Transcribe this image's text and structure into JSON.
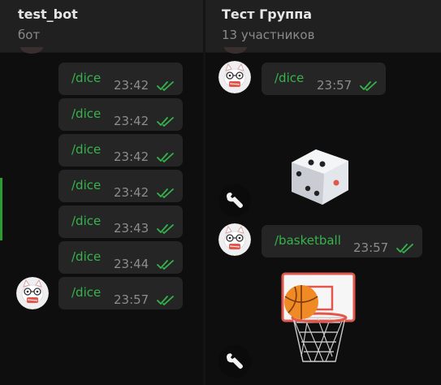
{
  "left_chat": {
    "title": "test_bot",
    "subtitle": "бот",
    "messages": [
      {
        "text": "/dice",
        "time": "23:42"
      },
      {
        "text": "/dice",
        "time": "23:42"
      },
      {
        "text": "/dice",
        "time": "23:42"
      },
      {
        "text": "/dice",
        "time": "23:42"
      },
      {
        "text": "/dice",
        "time": "23:43"
      },
      {
        "text": "/dice",
        "time": "23:44"
      },
      {
        "text": "/dice",
        "time": "23:57"
      }
    ]
  },
  "right_chat": {
    "title": "Тест Группа",
    "subtitle": "13 участников",
    "messages": [
      {
        "text": "/dice",
        "time": "23:57"
      },
      {
        "text": "/basketball",
        "time": "23:57"
      }
    ]
  },
  "icons": {
    "read_status": "double-check-icon",
    "bot_avatar": "wrench-icon",
    "user_avatar": "cat-avatar",
    "dice_result": "dice-sticker",
    "basketball_result": "basketball-hoop-sticker"
  },
  "colors": {
    "background": "#0e0e0e",
    "bubble": "#252525",
    "command_text": "#35b34c",
    "timestamp": "#8c8c8c",
    "header": "#202020"
  }
}
